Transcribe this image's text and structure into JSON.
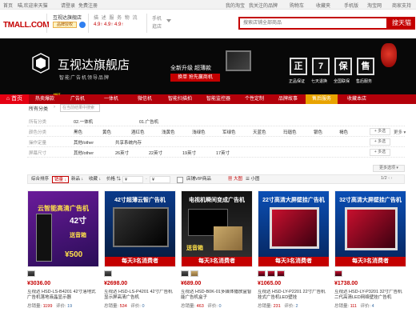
{
  "topbar": {
    "items": [
      "首页",
      "喵,欢迎来天猫",
      "请登录",
      "免费注册"
    ],
    "right_items": [
      "我的淘宝",
      "我关注的品牌",
      "购物车",
      "收藏夹",
      "手机版",
      "淘宝网",
      "商家支持"
    ]
  },
  "header": {
    "logo": "TMALL.COM",
    "shop_name": "互视达旗舰店",
    "shop_flag": "品牌授权",
    "rating_labels": [
      "描述",
      "服务",
      "物流"
    ],
    "rating_label_line2": [
      "描",
      "述",
      "服",
      "务",
      "物",
      "流"
    ],
    "ratings": [
      "4.9",
      "4.9",
      "4.9"
    ],
    "mobile_label_1": "手机",
    "mobile_label_2": "逛店",
    "search_placeholder": "搜索店铺全部商品",
    "search_button": "搜天猫"
  },
  "banner": {
    "name": "互视达旗舰店",
    "subtitle": "智能广告机领导品牌",
    "promo_line1": "全新升级 超薄款",
    "promo_line2": "换单 抢先赢商机",
    "badges": [
      {
        "char": "正",
        "label": "正品保证"
      },
      {
        "char": "7",
        "label": "七天退换"
      },
      {
        "char": "保",
        "label": "全国联保"
      },
      {
        "char": "售",
        "label": "售后服务"
      }
    ]
  },
  "nav": {
    "items": [
      "首页",
      "热卖爆款",
      "广告机",
      "一体机",
      "微信机",
      "智能扫描拍",
      "智能监控器",
      "个性定制",
      "品牌故事",
      "售后服务",
      "收藏本店"
    ],
    "hot_tag": "HOT"
  },
  "filters": {
    "crumb_label": "所有分类",
    "crumb_input_placeholder": "在当前结果中搜索",
    "rows": [
      {
        "label": "所有分类",
        "values": [
          "02.一体机",
          "01.广告机"
        ]
      },
      {
        "label": "颜色分类",
        "values": [
          "黑色",
          "黄色",
          "酒红色",
          "浅黄色",
          "浅绿色",
          "军绿色",
          "天蓝色",
          "玛瑙色",
          "银色",
          "褐色"
        ]
      },
      {
        "label": "操作定量",
        "values": [
          "其他/other",
          "共享系统内存"
        ]
      },
      {
        "label": "屏幕尺寸",
        "values": [
          "其他/other",
          "26英寸",
          "22英寸",
          "19英寸",
          "17英寸"
        ]
      }
    ],
    "more_button": "+ 多选",
    "expand_button": "更多选项 ▾"
  },
  "sortbar": {
    "items": [
      "综合排序",
      "销量",
      "新品",
      "收藏",
      "价格"
    ],
    "price_from": "¥",
    "price_to": "¥",
    "checkbox_label": "店铺VIP商品",
    "view_large": "大图",
    "view_small": "小图",
    "page_info": "1/2"
  },
  "products": [
    {
      "price": "¥3036.00",
      "title": "互视达 HSD-LS-B4201 42寸落地式广告机落地液晶显示器",
      "sales": "1199",
      "reviews": "19",
      "img_title": "云智能高清广告机",
      "img_size": "42寸",
      "img_bottom": "¥500",
      "img_tag": "送音箱"
    },
    {
      "price": "¥2698.00",
      "title": "互视达 HSD-LS-P4201 42寸广告机显示屏高清广告机",
      "sales": "534",
      "reviews": "0",
      "img_title": "42寸超薄云智广告机",
      "img_size": "",
      "img_bottom": "每天3名消费者",
      "img_tag": ""
    },
    {
      "price": "¥689.00",
      "title": "互视达 HSD-B0K-01多媒体播放盒智能广告机盒子",
      "sales": "463",
      "reviews": "0",
      "img_title": "电视机瞬间变成广告机",
      "img_size": "",
      "img_bottom": "每天3名消费者",
      "img_tag": "送音箱"
    },
    {
      "price": "¥1065.00",
      "title": "互视达 HSD-LY-P2201 22寸广告机挂式广告机LED壁挂",
      "sales": "231",
      "reviews": "2",
      "img_title": "22寸高清大屏壁挂广告机",
      "img_size": "",
      "img_bottom": "每天3名消费者",
      "img_tag": ""
    },
    {
      "price": "¥1738.00",
      "title": "互视达 HSD-LY-P3201 32寸广告机二代高清LED网络壁挂广告机",
      "sales": "111",
      "reviews": "4",
      "img_title": "32寸高清大屏壁挂广告机",
      "img_size": "",
      "img_bottom": "每天3名消费者",
      "img_tag": ""
    }
  ],
  "labels": {
    "sales": "总销量",
    "reviews": "评价"
  },
  "colors": {
    "brand_red": "#c40000",
    "nav_red": "#b3000a",
    "active_orange": "#e8a300"
  }
}
